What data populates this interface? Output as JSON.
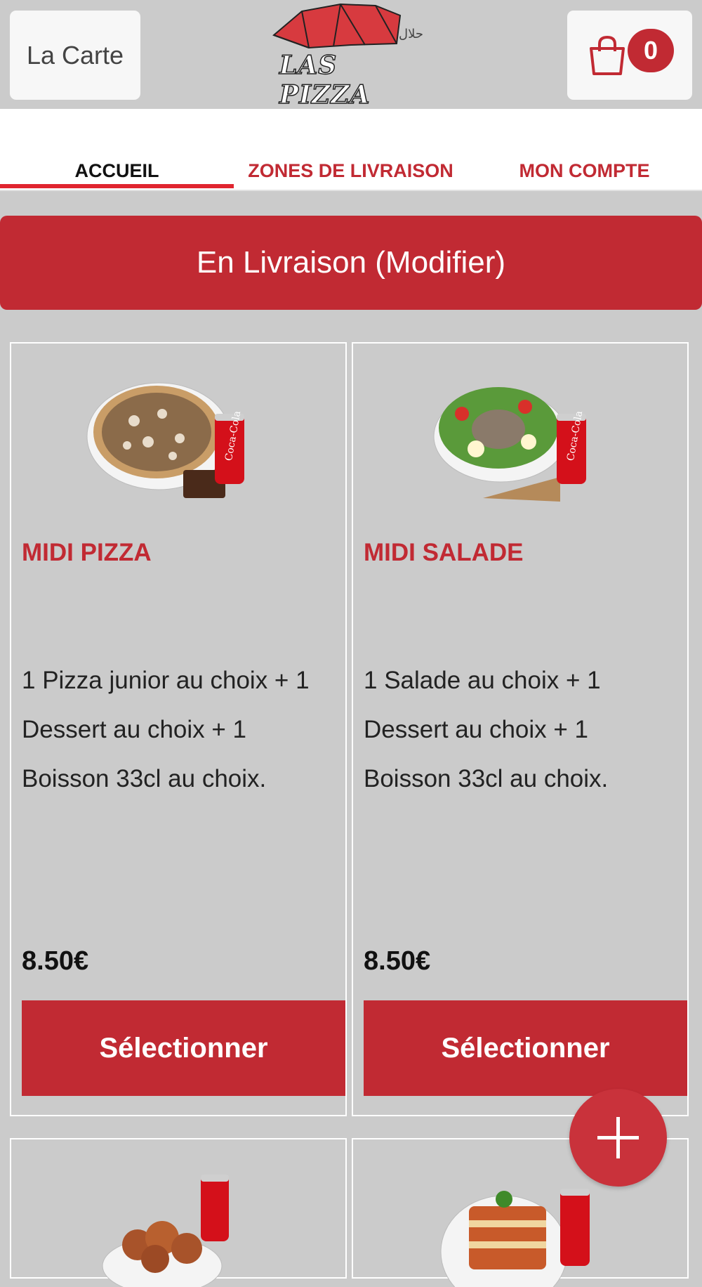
{
  "header": {
    "menu_label": "La Carte",
    "logo_text": "LAS PIZZA",
    "halal_text": "حلال",
    "cart_count": "0"
  },
  "tabs": [
    {
      "label": "ACCUEIL",
      "active": true
    },
    {
      "label": "ZONES DE LIVRAISON",
      "active": false
    },
    {
      "label": "MON COMPTE",
      "active": false
    }
  ],
  "delivery_bar": {
    "label": "En Livraison (Modifier)"
  },
  "products": [
    {
      "title": "MIDI PIZZA",
      "description": "1 Pizza junior au choix + 1 Dessert au choix + 1 Boisson 33cl au choix.",
      "price": "8.50€",
      "button": "Sélectionner",
      "image": "pizza-menu-photo"
    },
    {
      "title": "MIDI SALADE",
      "description": "1 Salade au choix + 1 Dessert au choix + 1 Boisson 33cl au choix.",
      "price": "8.50€",
      "button": "Sélectionner",
      "image": "salad-menu-photo"
    },
    {
      "image": "chicken-wings-menu-photo"
    },
    {
      "image": "lasagna-menu-photo"
    }
  ],
  "colors": {
    "brand_red": "#c12a33",
    "tab_indicator": "#e0252f",
    "background": "#cbcbcb"
  },
  "icons": [
    "shopping-bag-icon",
    "plus-icon"
  ]
}
